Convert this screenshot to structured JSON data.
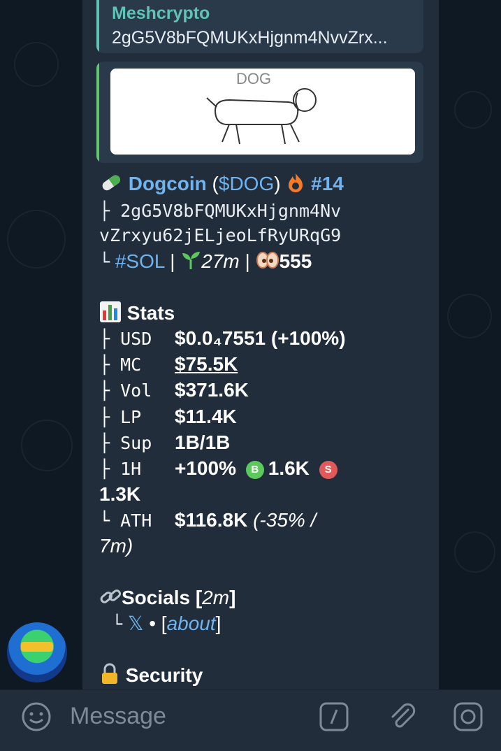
{
  "reply": {
    "title": "Meshcrypto",
    "subtitle": "2gG5V8bFQMUKxHjgnm4NvvZrx..."
  },
  "preview": {
    "image_text": "DOG"
  },
  "token": {
    "name": "Dogcoin",
    "paren_open": " (",
    "ticker": "$DOG",
    "paren_close": ")",
    "rank": "#14",
    "address_line1": "├ 2gG5V8bFQMUKxHjgnm4Nv",
    "address_line2": "vZrxyu62jELjeoLfRyURqG9",
    "tree_end": "└",
    "chain": "#SOL",
    "sep": "|",
    "age": "27m",
    "holders": "555"
  },
  "stats": {
    "heading": "Stats",
    "rows": [
      {
        "key": "├ USD",
        "value": "$0.0₄7551 (+100%)"
      },
      {
        "key": "├ MC",
        "value": "$75.5K"
      },
      {
        "key": "├ Vol",
        "value": "$371.6K"
      },
      {
        "key": "├ LP",
        "value": "$11.4K"
      },
      {
        "key": "├ Sup",
        "value": "1B/1B"
      }
    ],
    "h1_key": "├ 1H",
    "h1_change": "+100%",
    "buy_badge": "B",
    "buy_value": "1.6K",
    "sell_badge": "S",
    "sell_value": "1.3K",
    "ath_key": "└ ATH",
    "ath_value": "$116.8K",
    "ath_note_1": "(-35% /",
    "ath_note_2": "7m)"
  },
  "socials": {
    "heading": "Socials [",
    "age": "2m",
    "close": "]",
    "tree": "└",
    "x_label": "𝕏",
    "dot": "•",
    "about_open": "[",
    "about": "about",
    "about_close": "]"
  },
  "security": {
    "heading": "Security"
  },
  "composer": {
    "placeholder": "Message"
  },
  "colors": {
    "background": "#0f1923",
    "bubble": "#212d3b",
    "link": "#6fb3f0",
    "reply_accent": "#5fc3b6",
    "preview_accent": "#5fc96a",
    "buy": "#5cc95c",
    "sell": "#e05a5a",
    "fire": "#f47b2a"
  },
  "icons": [
    "pill-icon",
    "fire-icon",
    "seedling-icon",
    "eyes-icon",
    "bar-chart-icon",
    "link-icon",
    "lock-icon",
    "smiley-icon",
    "slash-command-icon",
    "attach-icon",
    "camera-icon"
  ]
}
